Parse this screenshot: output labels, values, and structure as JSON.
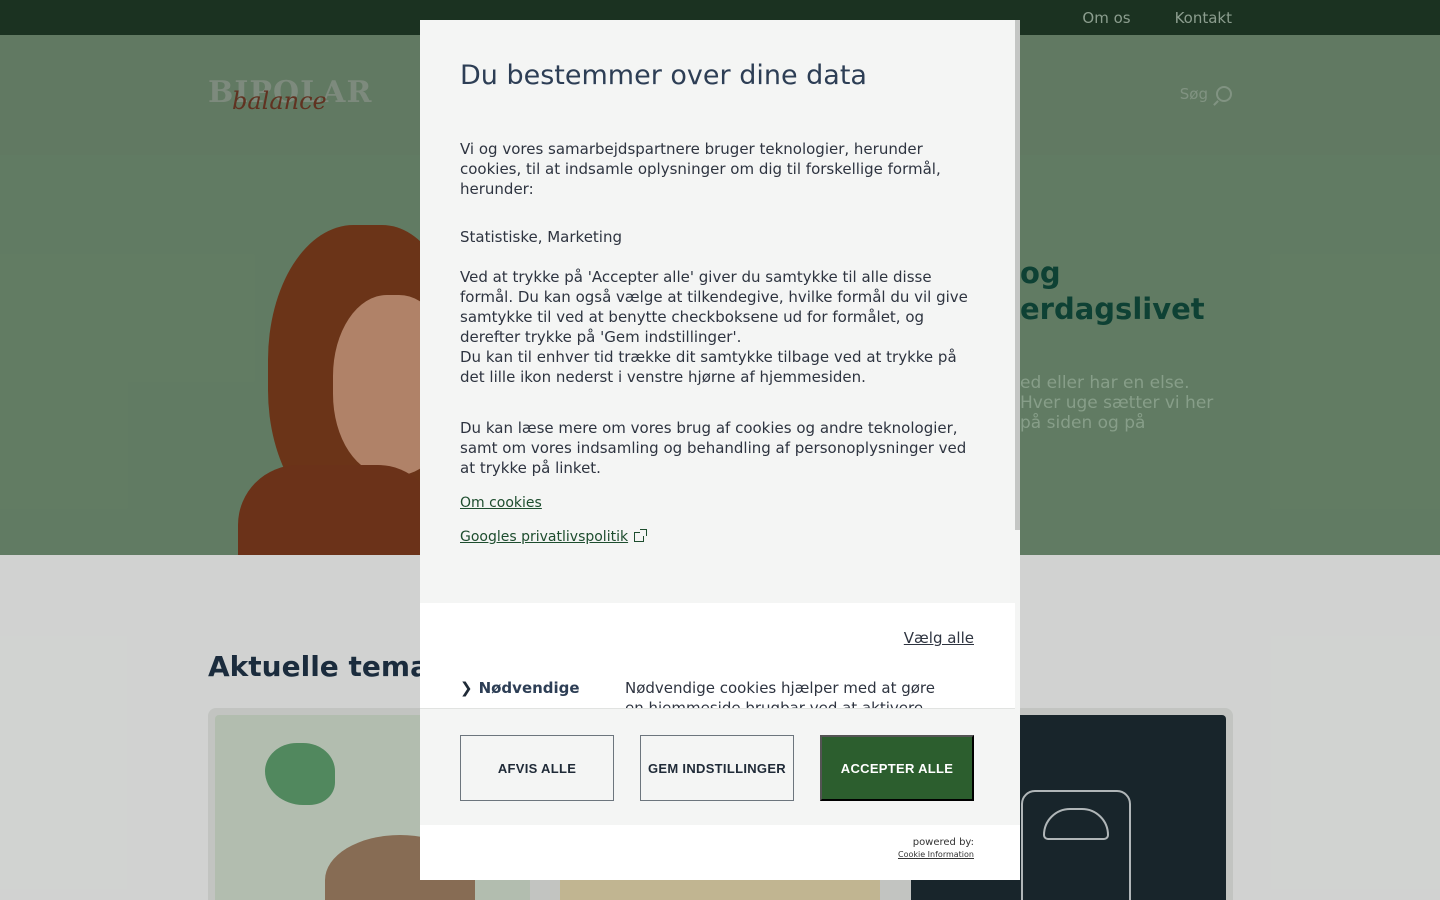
{
  "topbar": {
    "links": [
      "Om os",
      "Kontakt"
    ]
  },
  "header": {
    "logo_main": "BIPOLAR",
    "logo_script": "balance",
    "search_label": "Søg"
  },
  "hero": {
    "title_line1": "og",
    "title_line2": "erdagslivet",
    "text": "ed eller har en else. Hver uge sætter vi her på siden og på"
  },
  "themes": {
    "title": "Aktuelle temaer"
  },
  "consent": {
    "title": "Du bestemmer over dine data",
    "intro": "Vi og vores samarbejdspartnere bruger teknologier, herunder cookies, til at indsamle oplysninger om dig til forskellige formål, herunder:",
    "purposes": "Statistiske, Marketing",
    "accept_info": "Ved at trykke på 'Accepter alle' giver du samtykke til alle disse formål. Du kan også vælge at tilkendegive, hvilke formål du vil give samtykke til ved at benytte checkboksene ud for formålet, og derefter trykke på 'Gem indstillinger'.\nDu kan til enhver tid trække dit samtykke tilbage ved at trykke på det lille ikon nederst i venstre hjørne af hjemmesiden.",
    "read_more": "Du kan læse mere om vores brug af cookies og andre teknologier, samt om vores indsamling og behandling af personoplysninger ved at trykke på linket.",
    "link_cookies": "Om cookies",
    "link_google": "Googles privatlivspolitik",
    "select_all": "Vælg alle",
    "category_name": "Nødvendige",
    "category_desc": "Nødvendige cookies hjælper med at gøre en hjemmeside brugbar ved at aktivere",
    "btn_reject": "AFVIS ALLE",
    "btn_save": "GEM INDSTILLINGER",
    "btn_accept": "ACCEPTER ALLE",
    "powered_by": "powered by:",
    "powered_link": "Cookie Information"
  }
}
